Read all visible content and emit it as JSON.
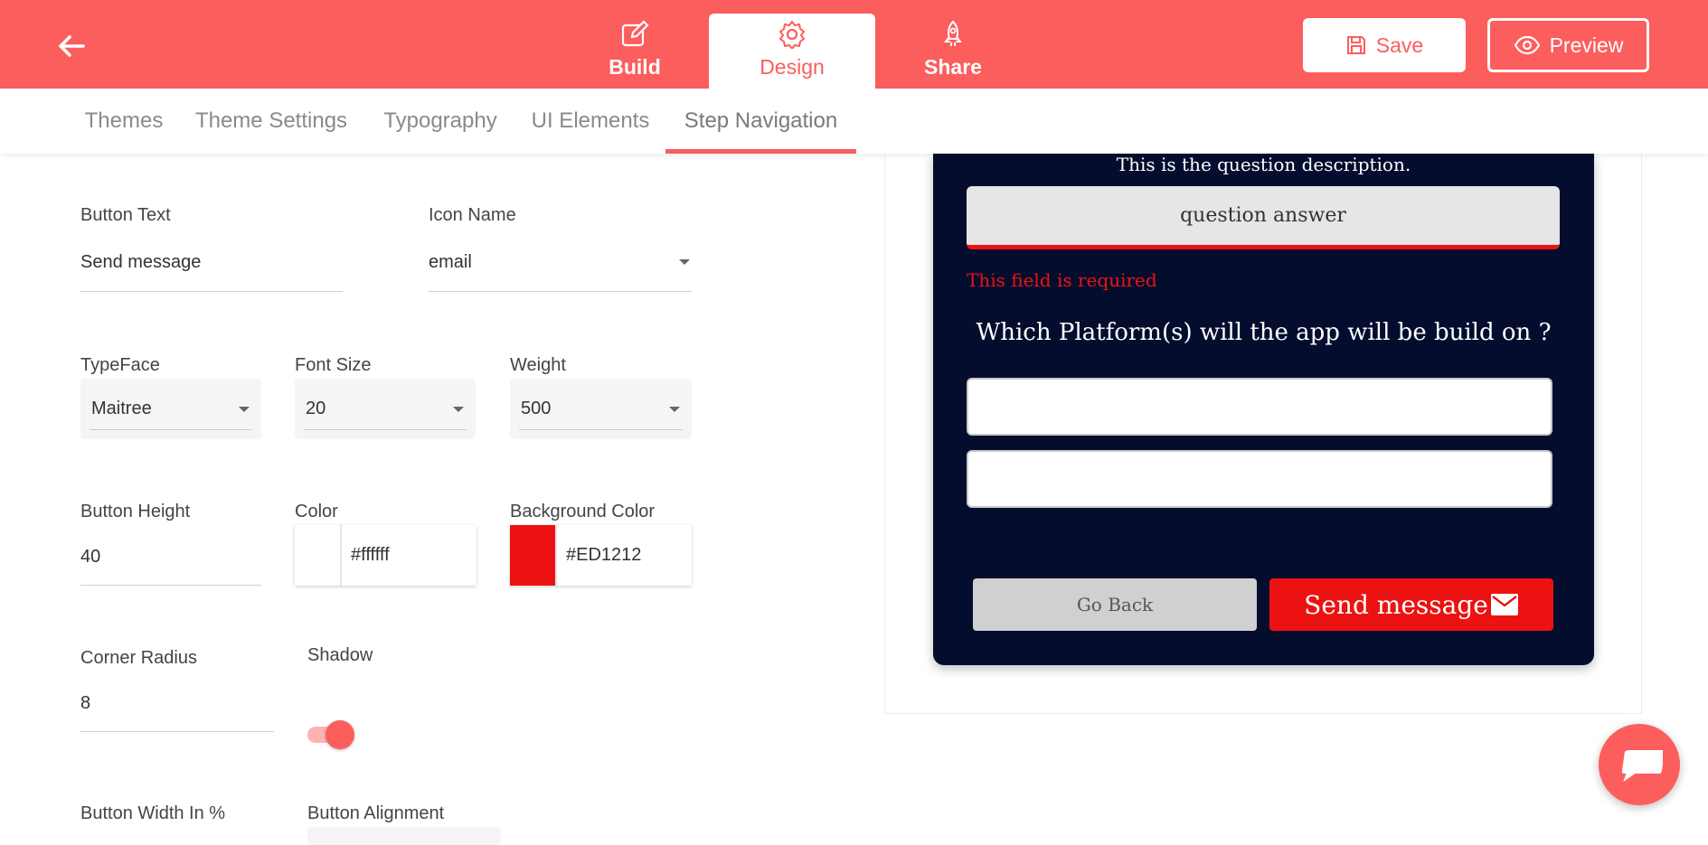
{
  "header": {
    "tabs": [
      {
        "label": "Build",
        "icon": "edit-icon"
      },
      {
        "label": "Design",
        "icon": "gear-icon",
        "active": true
      },
      {
        "label": "Share",
        "icon": "rocket-icon"
      }
    ],
    "save_label": "Save",
    "preview_label": "Preview",
    "accent_color": "#fc5d5d"
  },
  "subnav": {
    "items": [
      {
        "label": "Themes"
      },
      {
        "label": "Theme Settings"
      },
      {
        "label": "Typography"
      },
      {
        "label": "UI Elements"
      },
      {
        "label": "Step Navigation",
        "active": true
      }
    ]
  },
  "settings": {
    "button_text": {
      "label": "Button Text",
      "value": "Send message"
    },
    "icon_name": {
      "label": "Icon Name",
      "value": "email"
    },
    "typeface": {
      "label": "TypeFace",
      "value": "Maitree"
    },
    "font_size": {
      "label": "Font Size",
      "value": "20"
    },
    "weight": {
      "label": "Weight",
      "value": "500"
    },
    "button_height": {
      "label": "Button Height",
      "value": "40"
    },
    "color": {
      "label": "Color",
      "value": "#ffffff"
    },
    "background_color": {
      "label": "Background Color",
      "value": "#ED1212"
    },
    "corner_radius": {
      "label": "Corner Radius",
      "value": "8"
    },
    "shadow": {
      "label": "Shadow",
      "enabled": true
    },
    "button_width": {
      "label": "Button Width In %"
    },
    "button_alignment": {
      "label": "Button Alignment"
    }
  },
  "preview": {
    "question_description": "This is the question description.",
    "answer_text": "question answer",
    "error_text": "This field is required",
    "question2": "Which Platform(s) will the app will be build on ?",
    "go_back_label": "Go Back",
    "send_label": "Send message",
    "card_background": "#040d2e"
  }
}
